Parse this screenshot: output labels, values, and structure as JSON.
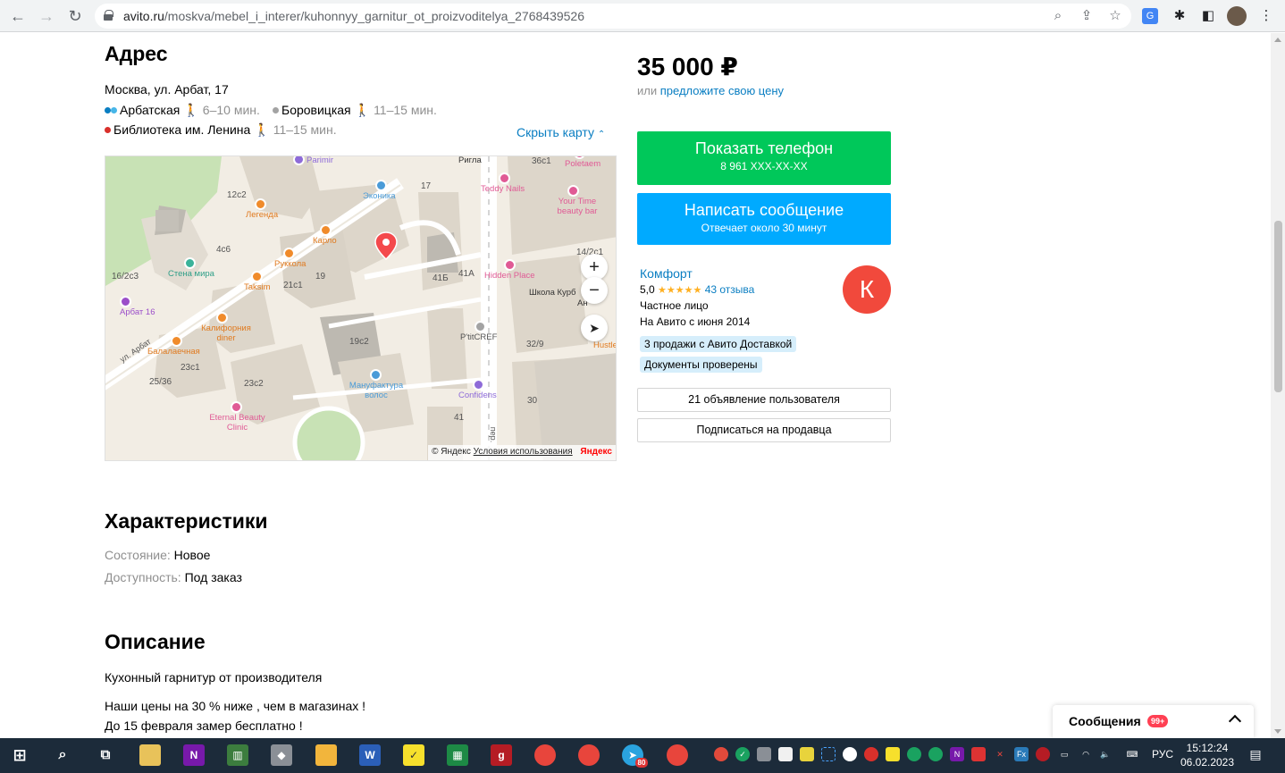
{
  "browser": {
    "url_host": "avito.ru",
    "url_path": "/moskva/mebel_i_interer/kuhonnyy_garnitur_ot_proizvoditelya_2768439526"
  },
  "address": {
    "heading": "Адрес",
    "street": "Москва, ул. Арбат, 17",
    "metro": [
      {
        "name": "Арбатская",
        "time": "6–10 мин.",
        "color": "#0a7ec2"
      },
      {
        "name": "Боровицкая",
        "time": "11–15 мин.",
        "color": "#a3a3a3"
      },
      {
        "name": "Библиотека им. Ленина",
        "time": "11–15 мин.",
        "color": "#d9302b"
      }
    ],
    "hide_map": "Скрыть карту"
  },
  "map": {
    "street_label": "ул. Арбат",
    "lane_label": "пер.",
    "poi": [
      {
        "name": "Parimir",
        "color": "#8e6bd8"
      },
      {
        "name": "Эконика",
        "color": "#4a9bd8"
      },
      {
        "name": "Легенда",
        "color": "#f08b2b"
      },
      {
        "name": "Карло",
        "color": "#f08b2b"
      },
      {
        "name": "Руккола",
        "color": "#f08b2b"
      },
      {
        "name": "Стена мира",
        "color": "#3bb39a"
      },
      {
        "name": "Taksim",
        "color": "#f08b2b"
      },
      {
        "name": "Арбат 16",
        "color": "#9b4ec9"
      },
      {
        "name": "Калифорния diner",
        "color": "#f08b2b"
      },
      {
        "name": "Балалаечная",
        "color": "#f08b2b"
      },
      {
        "name": "Мануфактура волос",
        "color": "#4a9bd8"
      },
      {
        "name": "Eternal Beauty Clinic",
        "color": "#e05a95"
      },
      {
        "name": "Teddy Nails",
        "color": "#e05a95"
      },
      {
        "name": "Your Time beauty bar",
        "color": "#e05a95"
      },
      {
        "name": "Poletaem",
        "color": "#e05a95"
      },
      {
        "name": "Hidden Place",
        "color": "#e05a95"
      },
      {
        "name": "P'titCREF",
        "color": "#8f8f8f"
      },
      {
        "name": "Confidens",
        "color": "#8e6bd8"
      },
      {
        "name": "Школа Курб",
        "color": "#333333"
      },
      {
        "name": "Ригла",
        "color": "#333333"
      },
      {
        "name": "Hustle",
        "color": "#f08b2b"
      },
      {
        "name": "Ан",
        "color": "#333333"
      }
    ],
    "buildings": [
      "12с2",
      "4с6",
      "16/2с3",
      "21с1",
      "19",
      "19с2",
      "23с1",
      "23с2",
      "25/36",
      "17",
      "41Б",
      "41А",
      "32/9",
      "30",
      "41",
      "36с1",
      "14/2с1"
    ],
    "zoom_in": "+",
    "zoom_out": "−",
    "attribution": "© Яндекс",
    "terms": "Условия использования",
    "brand": "Яндекс"
  },
  "characteristics": {
    "heading": "Характеристики",
    "rows": [
      {
        "label": "Состояние:",
        "value": "Новое"
      },
      {
        "label": "Доступность:",
        "value": "Под заказ"
      }
    ]
  },
  "description": {
    "heading": "Описание",
    "lines": [
      "Кухонный гарнитур от производителя",
      "Наши цены на 30 % ниже , чем в магазинах !",
      "До 15 февраля замер бесплатно !"
    ]
  },
  "offer": {
    "price": "35 000 ₽",
    "or": "или",
    "suggest": "предложите свою цену",
    "phone_btn": "Показать телефон",
    "phone_masked": "8 961 XXX-XX-XX",
    "message_btn": "Написать сообщение",
    "reply_time": "Отвечает около 30 минут"
  },
  "seller": {
    "name": "Комфорт",
    "rating": "5,0",
    "stars": "★★★★★",
    "reviews": "43 отзыва",
    "type": "Частное лицо",
    "since": "На Авито с июня 2014",
    "avatar_letter": "К",
    "badges": [
      "3 продажи с Авито Доставкой",
      "Документы проверены"
    ],
    "ads_btn": "21 объявление пользователя",
    "subscribe_btn": "Подписаться на продавца"
  },
  "messages": {
    "title": "Сообщения",
    "count": "99+"
  },
  "taskbar": {
    "lang": "РУС",
    "time": "15:12:24",
    "date": "06.02.2023",
    "badge_count": "80"
  }
}
